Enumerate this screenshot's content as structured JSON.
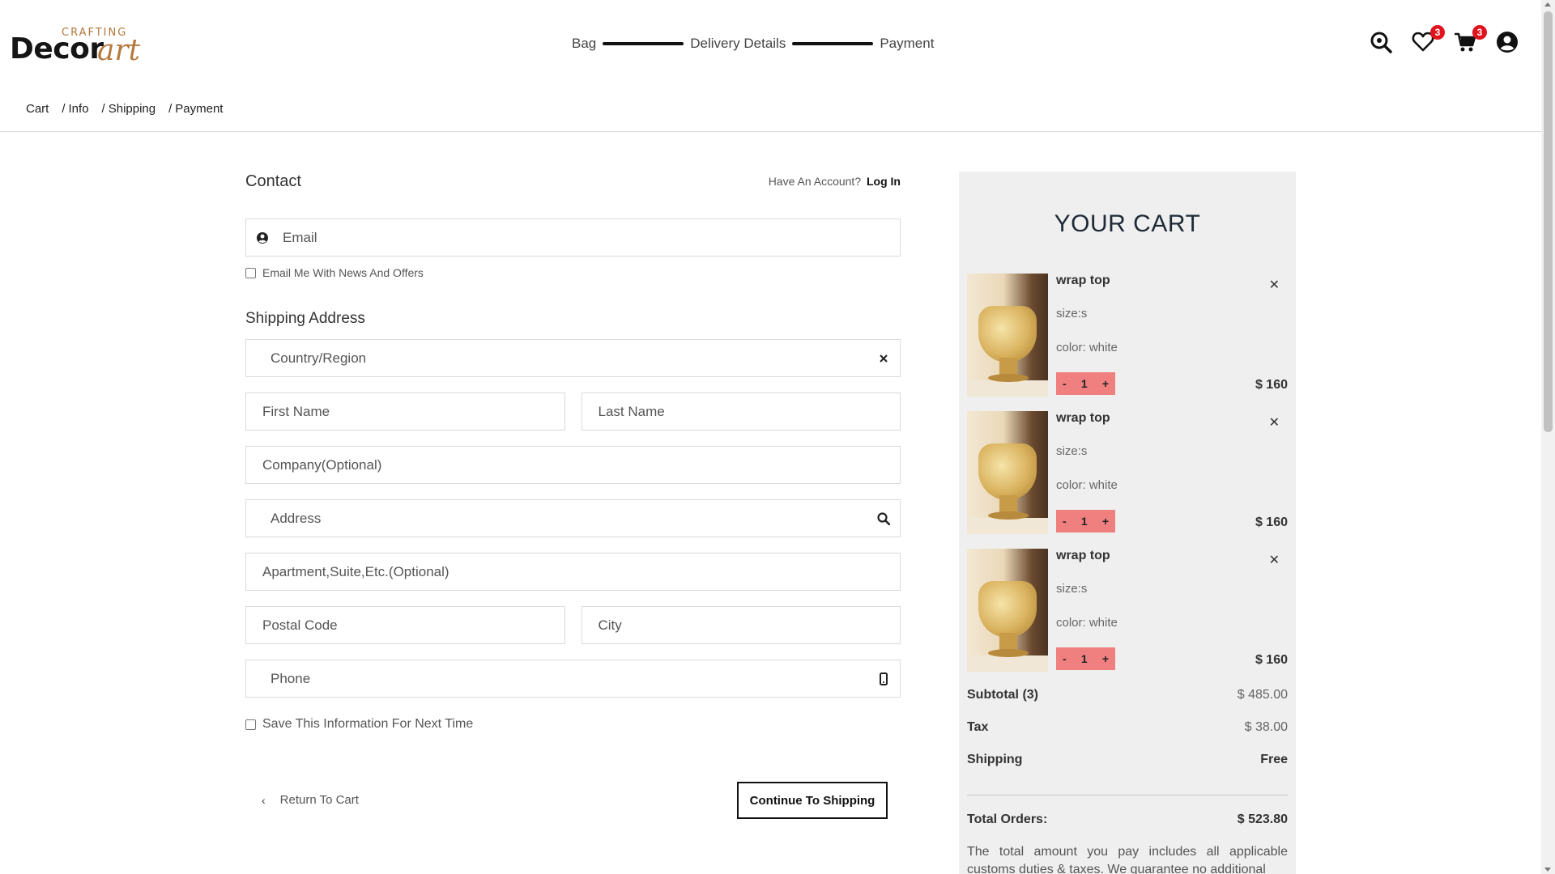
{
  "brand": {
    "logo_top": "CRAFTING",
    "logo_main": "Decor",
    "logo_accent": "art",
    "accent_color": "#b5793c"
  },
  "steps": [
    "Bag",
    "Delivery Details",
    "Payment"
  ],
  "header_icons": {
    "search": "search-icon",
    "wishlist": "heart-icon",
    "wishlist_count": "3",
    "cart": "cart-icon",
    "cart_count": "3",
    "account": "user-icon"
  },
  "breadcrumb": [
    "Cart",
    "Info",
    "Shipping",
    "Payment"
  ],
  "contact": {
    "title": "Contact",
    "have_account": "Have An Account?",
    "login": "Log In",
    "email_placeholder": "Email",
    "newsletter_label": "Email Me With News And Offers"
  },
  "shipping": {
    "title": "Shipping Address",
    "country_placeholder": "Country/Region",
    "first_name_placeholder": "First Name",
    "last_name_placeholder": "Last Name",
    "company_placeholder": "Company(Optional)",
    "address_placeholder": "Address",
    "apartment_placeholder": "Apartment,Suite,Etc.(Optional)",
    "postal_placeholder": "Postal Code",
    "city_placeholder": "City",
    "phone_placeholder": "Phone",
    "save_info_label": "Save This Information For Next Time"
  },
  "actions": {
    "return_label": "Return To Cart",
    "continue_label": "Continue To Shipping"
  },
  "cart": {
    "title": "YOUR CART",
    "items": [
      {
        "name": "wrap top",
        "size": "size:s",
        "color": "color: white",
        "qty": "1",
        "price": "$ 160"
      },
      {
        "name": "wrap top",
        "size": "size:s",
        "color": "color: white",
        "qty": "1",
        "price": "$ 160"
      },
      {
        "name": "wrap top",
        "size": "size:s",
        "color": "color: white",
        "qty": "1",
        "price": "$ 160"
      }
    ],
    "subtotal_label": "Subtotal (3)",
    "subtotal_value": "$ 485.00",
    "tax_label": "Tax",
    "tax_value": "$ 38.00",
    "shipping_label": "Shipping",
    "shipping_value": "Free",
    "total_label": "Total Orders:",
    "total_value": "$ 523.80",
    "note": "The total amount you pay includes all applicable customs duties & taxes. We guarantee no additional"
  },
  "colors": {
    "qty_bg": "#f08080",
    "badge": "#e1141e",
    "cart_bg": "#efefef"
  }
}
